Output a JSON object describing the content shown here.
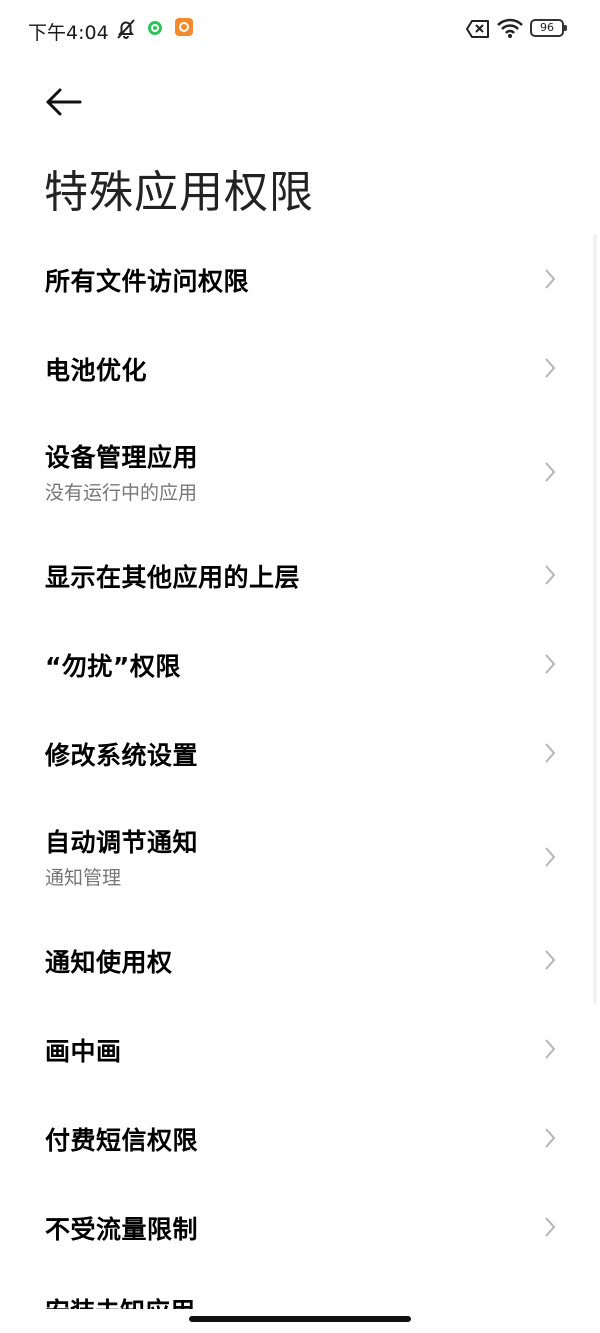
{
  "status_bar": {
    "time": "下午4:04",
    "battery": "96",
    "icons": [
      "mute-bell-icon",
      "green-circle-app-icon",
      "orange-app-icon",
      "no-sim-icon",
      "wifi-icon",
      "battery-icon"
    ]
  },
  "header": {
    "back_icon": "back-arrow-icon",
    "title": "特殊应用权限"
  },
  "items": [
    {
      "label": "所有文件访问权限",
      "sub": ""
    },
    {
      "label": "电池优化",
      "sub": ""
    },
    {
      "label": "设备管理应用",
      "sub": "没有运行中的应用"
    },
    {
      "label": "显示在其他应用的上层",
      "sub": ""
    },
    {
      "label": "“勿扰”权限",
      "sub": ""
    },
    {
      "label": "修改系统设置",
      "sub": ""
    },
    {
      "label": "自动调节通知",
      "sub": "通知管理"
    },
    {
      "label": "通知使用权",
      "sub": ""
    },
    {
      "label": "画中画",
      "sub": ""
    },
    {
      "label": "付费短信权限",
      "sub": ""
    },
    {
      "label": "不受流量限制",
      "sub": ""
    }
  ],
  "partial_item": "安装未知应用",
  "chevron_icon": "chevron-right-icon"
}
